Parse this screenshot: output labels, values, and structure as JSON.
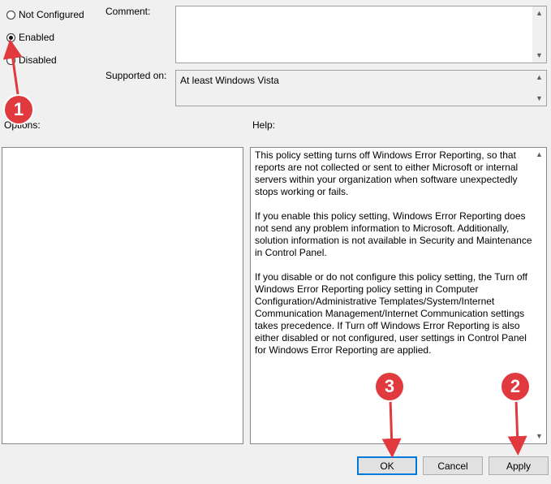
{
  "state": {
    "options": [
      {
        "label": "Not Configured",
        "checked": false
      },
      {
        "label": "Enabled",
        "checked": true
      },
      {
        "label": "Disabled",
        "checked": false
      }
    ]
  },
  "comment": {
    "label": "Comment:",
    "value": ""
  },
  "supported": {
    "label": "Supported on:",
    "value": "At least Windows Vista"
  },
  "options_panel": {
    "label": "Options:"
  },
  "help_panel": {
    "label": "Help:",
    "text": "This policy setting turns off Windows Error Reporting, so that\nreports are not collected or sent to either Microsoft or internal\nservers within your organization when software unexpectedly\nstops working or fails.\n\nIf you enable this policy setting, Windows Error Reporting does\nnot send any problem information to Microsoft. Additionally,\nsolution information is not available in Security and Maintenance\nin Control Panel.\n\nIf you disable or do not configure this policy setting, the Turn off\nWindows Error Reporting policy setting in Computer\nConfiguration/Administrative Templates/System/Internet\nCommunication Management/Internet Communication settings\ntakes precedence. If Turn off Windows Error Reporting is also\neither disabled or not configured, user settings in Control Panel\nfor Windows Error Reporting are applied."
  },
  "buttons": {
    "ok": "OK",
    "cancel": "Cancel",
    "apply": "Apply"
  },
  "annotations": {
    "step1": "1",
    "step2": "2",
    "step3": "3",
    "color": "#e0393e"
  },
  "icons": {
    "up": "scroll-up-icon",
    "down": "scroll-down-icon"
  }
}
